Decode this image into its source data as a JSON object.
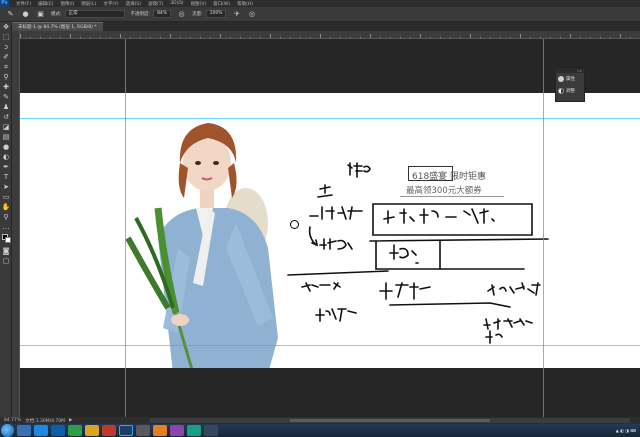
{
  "menubar": {
    "logo": "Ps",
    "items": [
      "文件(F)",
      "编辑(E)",
      "图像(I)",
      "图层(L)",
      "文字(Y)",
      "选择(S)",
      "滤镜(T)",
      "3D(D)",
      "视图(V)",
      "窗口(W)",
      "帮助(H)"
    ]
  },
  "options": {
    "mode_label": "模式:",
    "mode_value": "正常",
    "opacity_label": "不透明度:",
    "opacity_value": "84%",
    "flow_label": "流量:",
    "flow_value": "100%"
  },
  "document_tab": "未标题-1 @ 84.7% (图层 1, RGB/8) *",
  "panel": {
    "items": [
      {
        "label": "属性"
      },
      {
        "label": "调整"
      }
    ]
  },
  "canvas_text": {
    "promo_title": "618盛宴 限时钜惠",
    "promo_sub": "最高领300元大额券"
  },
  "status": {
    "zoom": "84.77%",
    "doc_info": "文档:1.30M/4.70M"
  },
  "colors": {
    "guide": "#00bfff",
    "canvas": "#ffffff",
    "workspace": "#262626",
    "accent": "#31a8ff"
  }
}
